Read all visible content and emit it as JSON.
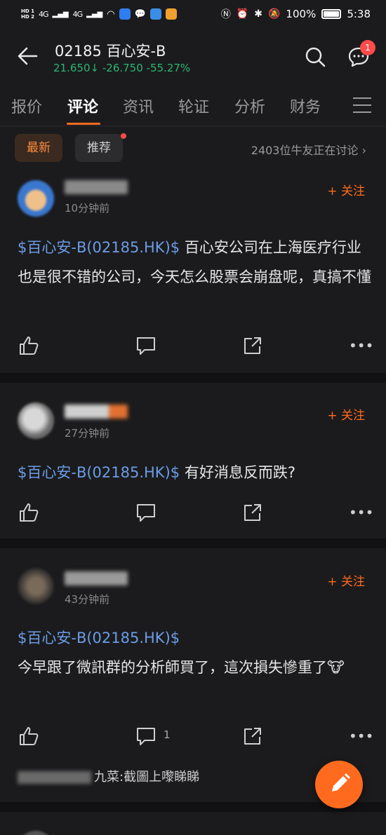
{
  "status_bar": {
    "hd1": "HD 1",
    "hd2": "HD 2",
    "signal1": "4G",
    "signal2": "4G",
    "battery": "100%",
    "time": "5:38"
  },
  "header": {
    "title": "02185  百心安-B",
    "price": "21.650",
    "change": "-26.750",
    "change_pct": "-55.27%",
    "badge_count": "1",
    "down_color": "#2bb673",
    "accent_color": "#ff6a1f"
  },
  "tabs": [
    {
      "label": "报价"
    },
    {
      "label": "评论"
    },
    {
      "label": "资讯"
    },
    {
      "label": "轮证"
    },
    {
      "label": "分析"
    },
    {
      "label": "财务"
    }
  ],
  "filters": {
    "latest": "最新",
    "recommend": "推荐",
    "discuss_count": "2403位牛友正在讨论"
  },
  "posts": [
    {
      "time": "10分钟前",
      "follow": "+ 关注",
      "stock_tag": "$百心安-B(02185.HK)$",
      "text": "百心安公司在上海医疗行业也是很不错的公司，今天怎么股票会崩盘呢，真搞不懂"
    },
    {
      "time": "27分钟前",
      "follow": "+ 关注",
      "stock_tag": "$百心安-B(02185.HK)$",
      "text": "有好消息反而跌?"
    },
    {
      "time": "43分钟前",
      "follow": "+ 关注",
      "stock_tag": "$百心安-B(02185.HK)$",
      "text": "今早跟了微訊群的分析師買了，這次損失慘重了",
      "comment_count": "1",
      "reply_name": "九菜",
      "reply_text": ":截圖上嚟睇睇"
    }
  ]
}
